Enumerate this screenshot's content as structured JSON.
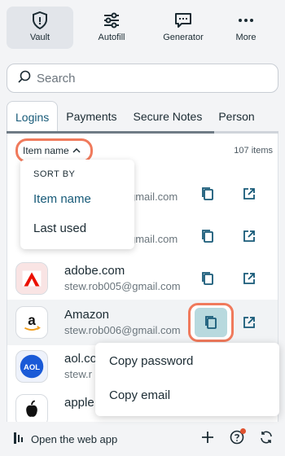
{
  "nav": {
    "items": [
      {
        "label": "Vault",
        "icon": "shield-icon",
        "active": true
      },
      {
        "label": "Autofill",
        "icon": "sliders-icon",
        "active": false
      },
      {
        "label": "Generator",
        "icon": "generator-icon",
        "active": false
      },
      {
        "label": "More",
        "icon": "more-dots-icon",
        "active": false
      }
    ]
  },
  "search": {
    "placeholder": "Search"
  },
  "tabs": [
    "Logins",
    "Payments",
    "Secure Notes",
    "Person"
  ],
  "list": {
    "sort_label": "Item name",
    "count": "107 items",
    "items": [
      {
        "name": "",
        "email": "gmail.com"
      },
      {
        "name": "",
        "email": "gmail.com"
      },
      {
        "name": "adobe.com",
        "email": "stew.rob005@gmail.com"
      },
      {
        "name": "Amazon",
        "email": "stew.rob006@gmail.com"
      },
      {
        "name": "aol.co",
        "email": "stew.r"
      },
      {
        "name": "apple.",
        "email": ""
      }
    ]
  },
  "sort_menu": {
    "header": "SORT BY",
    "options": [
      "Item name",
      "Last used"
    ]
  },
  "context_menu": {
    "options": [
      "Copy password",
      "Copy email"
    ]
  },
  "footer": {
    "web_app_label": "Open the web app"
  },
  "colors": {
    "accent": "#175a78",
    "highlight_ring": "#f07a5c",
    "copy_active_bg": "#b8d9de",
    "notification_dot": "#e0522f"
  }
}
